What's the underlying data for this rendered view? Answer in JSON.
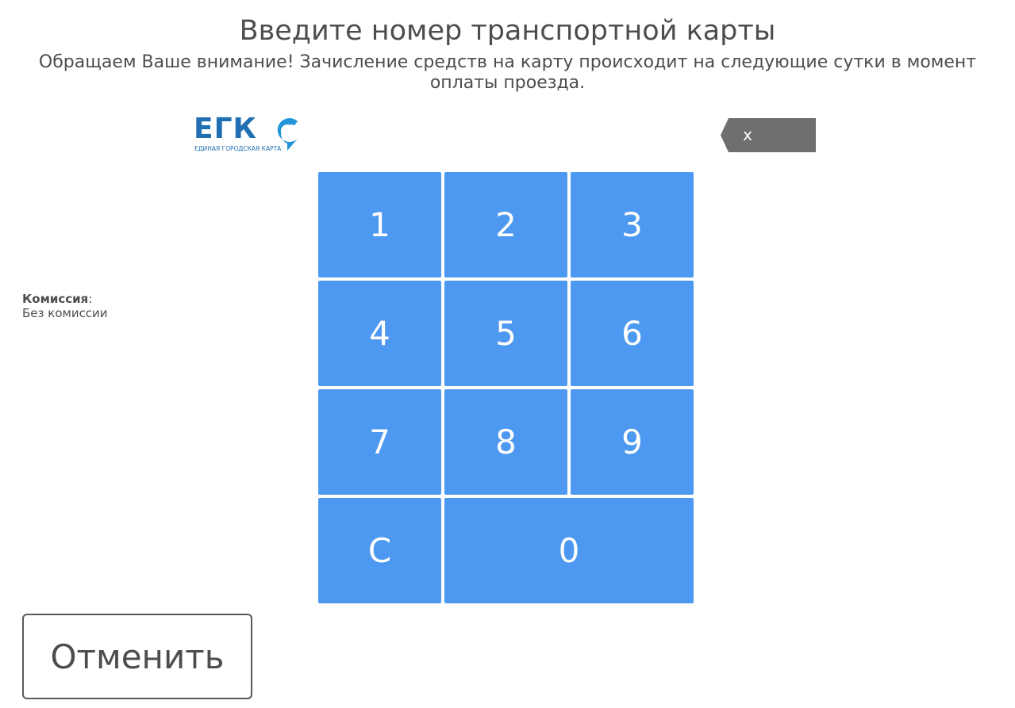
{
  "header": {
    "title": "Введите номер транспортной карты",
    "notice": "Обращаем Ваше внимание! Зачисление средств на карту происходит на следующие сутки в момент оплаты проезда."
  },
  "logo": {
    "text": "ЕГК",
    "subtitle": "ЕДИНАЯ ГОРОДСКАЯ КАРТА",
    "color": "#1f6fb2",
    "mark_color": "#2196d8"
  },
  "backspace": {
    "label": "x",
    "color": "#6f6f6f"
  },
  "keypad": {
    "color": "#4d98f0",
    "keys": [
      "1",
      "2",
      "3",
      "4",
      "5",
      "6",
      "7",
      "8",
      "9",
      "C",
      "0"
    ]
  },
  "commission": {
    "label": "Комиссия",
    "separator": ":",
    "value": "Без комиссии"
  },
  "cancel": {
    "label": "Отменить"
  }
}
